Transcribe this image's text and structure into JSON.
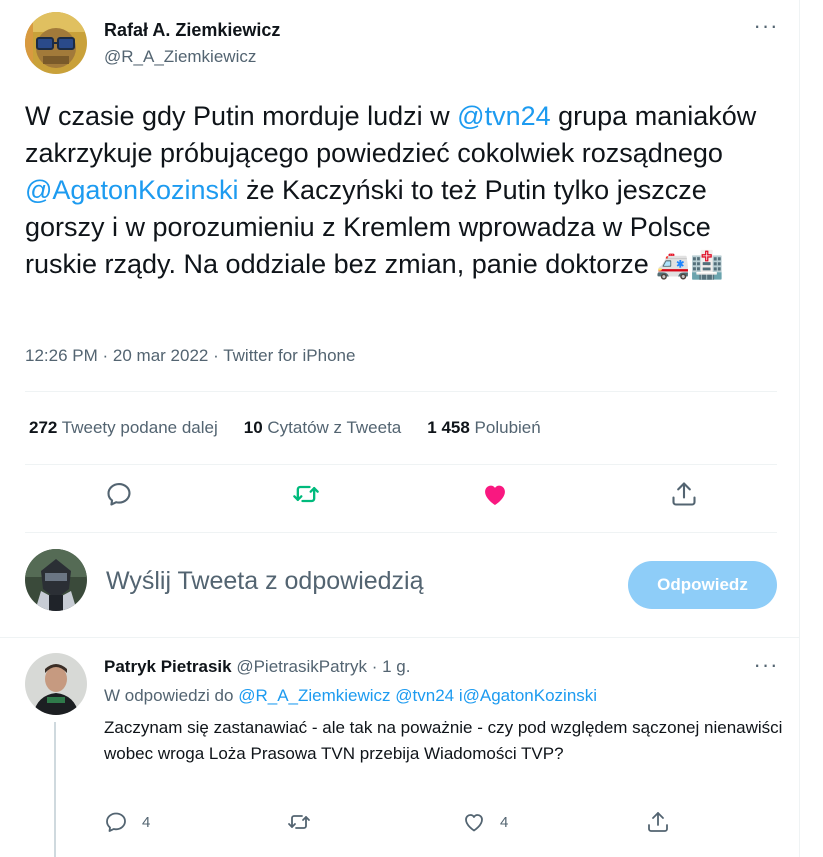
{
  "main_tweet": {
    "author_name": "Rafał A. Ziemkiewicz",
    "author_handle": "@R_A_Ziemkiewicz",
    "text_part1": "W czasie gdy Putin morduje ludzi w ",
    "mention_tvn24": "@tvn24",
    "text_part2": " grupa maniaków zakrzykuje próbującego powiedzieć cokolwiek rozsądnego ",
    "mention_agaton": "@AgatonKozinski",
    "text_part3": " że Kaczyński to też Putin tylko jeszcze gorszy i w porozumieniu z Kremlem wprowadza w Polsce ruskie rządy. Na oddziale bez zmian, panie doktorze ",
    "emoji_ambulance": "🚑",
    "emoji_hospital": "🏥",
    "time": "12:26 PM",
    "separator": "·",
    "date": "20 mar 2022",
    "source": "Twitter for iPhone"
  },
  "stats": {
    "retweets_count": "272",
    "retweets_label": "Tweety podane dalej",
    "quotes_count": "10",
    "quotes_label": "Cytatów z Tweeta",
    "likes_count": "1 458",
    "likes_label": "Polubień"
  },
  "compose": {
    "placeholder": "Wyślij Tweeta z odpowiedzią",
    "button_label": "Odpowiedz"
  },
  "reply_tweet": {
    "author_name": "Patryk Pietrasik",
    "author_handle": "@PietrasikPatryk",
    "separator": "·",
    "age": "1 g.",
    "in_reply_prefix": "W odpowiedzi do",
    "in_reply_handles": "@R_A_Ziemkiewicz @tvn24 i@AgatonKozinski",
    "text": "Zaczynam się zastanawiać - ale tak na poważnie - czy pod względem sączonej nienawiści wobec wroga Loża Prasowa TVN przebija Wiadomości TVP?",
    "reply_count": "4",
    "like_count": "4"
  },
  "colors": {
    "accent": "#1d9bf0",
    "retweet_green": "#00ba7c",
    "like_pink": "#f91880",
    "reply_button": "#8ecdf8",
    "secondary_text": "#536471"
  },
  "icons": {
    "reply": "reply-icon",
    "retweet": "retweet-icon",
    "like": "heart-icon",
    "share": "share-icon",
    "more": "more-icon"
  }
}
